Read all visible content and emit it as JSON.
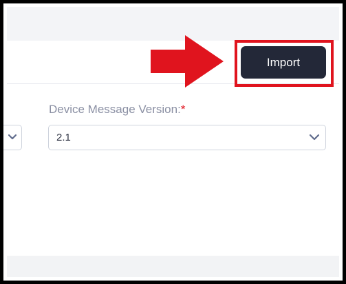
{
  "toolbar": {
    "import_label": "Import"
  },
  "form": {
    "device_message_version": {
      "label": "Device Message Version:",
      "required_marker": "*",
      "value": "2.1"
    }
  },
  "icons": {
    "chevron": "chevron-down-icon",
    "annotation_arrow": "right-arrow-icon"
  },
  "colors": {
    "button_bg": "#232838",
    "annotation_red": "#e0141e",
    "label_grey": "#8a8fa3",
    "chevron_blue": "#5f6b8c"
  }
}
